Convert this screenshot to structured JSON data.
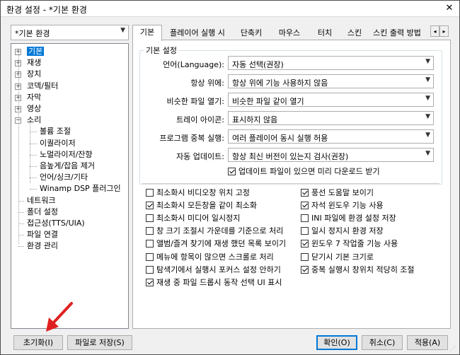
{
  "window": {
    "title": "환경 설정 - *기본 환경",
    "close_label": "✕"
  },
  "profile": {
    "value": "*기본 환경"
  },
  "tree": {
    "items": [
      {
        "label": "기본",
        "selected": true
      },
      {
        "label": "재생"
      },
      {
        "label": "장치"
      },
      {
        "label": "코덱/필터"
      },
      {
        "label": "자막"
      },
      {
        "label": "영상"
      },
      {
        "label": "소리"
      },
      {
        "label": "볼륨 조절"
      },
      {
        "label": "이퀄라이저"
      },
      {
        "label": "노멀라이저/잔향"
      },
      {
        "label": "음높게/잡음 제거"
      },
      {
        "label": "언어/싱크/기타"
      },
      {
        "label": "Winamp DSP 플러그인"
      },
      {
        "label": "네트워크"
      },
      {
        "label": "폴더 설정"
      },
      {
        "label": "접근성(TTS/UIA)"
      },
      {
        "label": "파일 연결"
      },
      {
        "label": "환경 관리"
      }
    ]
  },
  "tabs": [
    "기본",
    "플레이어 실행 시",
    "단축키",
    "마우스",
    "터치",
    "스킨",
    "스킨 출력 방법"
  ],
  "tab_scroll": {
    "left": "◂",
    "right": "▸"
  },
  "basic": {
    "group_label": "기본 설정",
    "rows": [
      {
        "label": "언어(Language):",
        "value": "자동 선택(권장)"
      },
      {
        "label": "항상 위에:",
        "value": "항상 위에 기능 사용하지 않음"
      },
      {
        "label": "비슷한 파일 열기:",
        "value": "비슷한 파일 같이 열기"
      },
      {
        "label": "트레이 아이콘:",
        "value": "표시하지 않음"
      },
      {
        "label": "프로그램 중복 실행:",
        "value": "여러 플레이어 동시 실행 허용"
      },
      {
        "label": "자동 업데이트:",
        "value": "항상 최신 버전이 있는지 검사(권장)"
      }
    ],
    "update_check": {
      "label": "업데이트 파일이 있으면 미리 다운로드 받기",
      "checked": true
    }
  },
  "options_left": [
    {
      "label": "최소화시 비디오창 위치 고정",
      "checked": false
    },
    {
      "label": "최소화시 모든창을 같이 최소화",
      "checked": true
    },
    {
      "label": "최소화시 미디어 일시정지",
      "checked": false
    },
    {
      "label": "창 크기 조절시 가운데를 기준으로 처리",
      "checked": false
    },
    {
      "label": "앨범/즐겨 찾기에 재생 했던 목록 보이기",
      "checked": false
    },
    {
      "label": "메뉴에 항목이 많으면 스크롤로 처리",
      "checked": false
    },
    {
      "label": "탐색기에서 실행시 포커스 설정 안하기",
      "checked": false
    },
    {
      "label": "재생 중 파일 드롭시 동작 선택 UI 표시",
      "checked": true
    }
  ],
  "options_right": [
    {
      "label": "풍선 도움말 보이기",
      "checked": true
    },
    {
      "label": "자석 윈도우 기능 사용",
      "checked": true
    },
    {
      "label": "INI 파일에 환경 설정 저장",
      "checked": false
    },
    {
      "label": "일시 정지시 환경 저장",
      "checked": false
    },
    {
      "label": "윈도우 7 작업줄 기능 사용",
      "checked": true
    },
    {
      "label": "닫기시 기본 크기로",
      "checked": false
    },
    {
      "label": "중복 실행시 창위치 적당히 조절",
      "checked": true
    }
  ],
  "buttons": {
    "reset": "초기화(I)",
    "save_file": "파일로 저장(S)",
    "ok": "확인(O)",
    "cancel": "취소(C)",
    "apply": "적용(A)"
  },
  "colors": {
    "selection": "#0078d7",
    "annotation_arrow": "#e02020"
  }
}
